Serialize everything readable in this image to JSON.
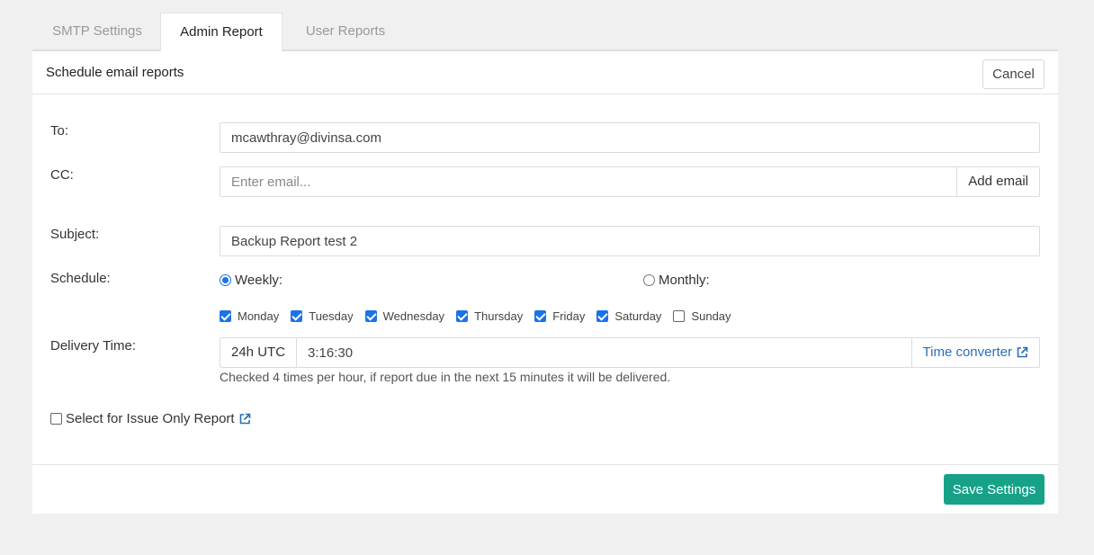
{
  "tabs": [
    {
      "label": "SMTP Settings"
    },
    {
      "label": "Admin Report"
    },
    {
      "label": "User Reports"
    }
  ],
  "panel": {
    "title": "Schedule email reports",
    "cancel_label": "Cancel",
    "save_label": "Save Settings"
  },
  "form": {
    "to_label": "To:",
    "to_value": "mcawthray@divinsa.com",
    "cc_label": "CC:",
    "cc_placeholder": "Enter email...",
    "add_email_label": "Add email",
    "subject_label": "Subject:",
    "subject_value": "Backup Report test 2",
    "schedule_label": "Schedule:",
    "weekly_label": "Weekly:",
    "monthly_label": "Monthly:",
    "days": [
      {
        "label": "Monday",
        "checked": true
      },
      {
        "label": "Tuesday",
        "checked": true
      },
      {
        "label": "Wednesday",
        "checked": true
      },
      {
        "label": "Thursday",
        "checked": true
      },
      {
        "label": "Friday",
        "checked": true
      },
      {
        "label": "Saturday",
        "checked": true
      },
      {
        "label": "Sunday",
        "checked": false
      }
    ],
    "delivery_label": "Delivery Time:",
    "tz_label": "24h UTC",
    "delivery_value": "3:16:30",
    "time_converter_label": "Time converter",
    "hint": "Checked 4 times per hour, if report due in the next 15 minutes it will be delivered.",
    "issue_only_label": "Select for Issue Only Report"
  },
  "colors": {
    "accent": "#17a288",
    "link": "#2a6fb8",
    "checkbox": "#1a73e8"
  },
  "icons": {
    "external_link": "external-link-icon"
  }
}
